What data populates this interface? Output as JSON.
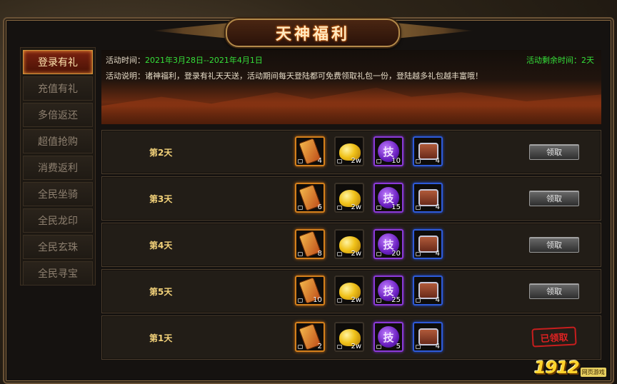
{
  "window": {
    "title": "天神福利"
  },
  "sidebar": {
    "items": [
      {
        "label": "登录有礼",
        "active": true
      },
      {
        "label": "充值有礼",
        "active": false
      },
      {
        "label": "多倍返还",
        "active": false
      },
      {
        "label": "超值抢购",
        "active": false
      },
      {
        "label": "消费返利",
        "active": false
      },
      {
        "label": "全民坐骑",
        "active": false
      },
      {
        "label": "全民龙印",
        "active": false
      },
      {
        "label": "全民玄珠",
        "active": false
      },
      {
        "label": "全民寻宝",
        "active": false
      }
    ]
  },
  "banner": {
    "time_label": "活动时间：",
    "time_value": "2021年3月28日--2021年4月1日",
    "remain_label": "活动剩余时间：",
    "remain_value": "2天",
    "desc": "活动说明：诸神福利，登录有礼天天送，活动期间每天登陆都可免费领取礼包一份，登陆越多礼包越丰富哦！"
  },
  "rows": [
    {
      "day": "第2天",
      "counts": [
        "4",
        "2w",
        "10",
        "4"
      ],
      "action": "领取",
      "claimed": false
    },
    {
      "day": "第3天",
      "counts": [
        "6",
        "2w",
        "15",
        "4"
      ],
      "action": "领取",
      "claimed": false
    },
    {
      "day": "第4天",
      "counts": [
        "8",
        "2w",
        "20",
        "4"
      ],
      "action": "领取",
      "claimed": false
    },
    {
      "day": "第5天",
      "counts": [
        "10",
        "2w",
        "25",
        "4"
      ],
      "action": "领取",
      "claimed": false
    },
    {
      "day": "第1天",
      "counts": [
        "2",
        "2w",
        "5",
        "4"
      ],
      "action": "已领取",
      "claimed": true
    }
  ],
  "item_icons": [
    "scroll-icon",
    "gold-coins-icon",
    "skill-orb-icon",
    "chest-icon"
  ],
  "skill_glyph": "技",
  "logo": {
    "text": "1912",
    "badge": "网页游戏"
  }
}
